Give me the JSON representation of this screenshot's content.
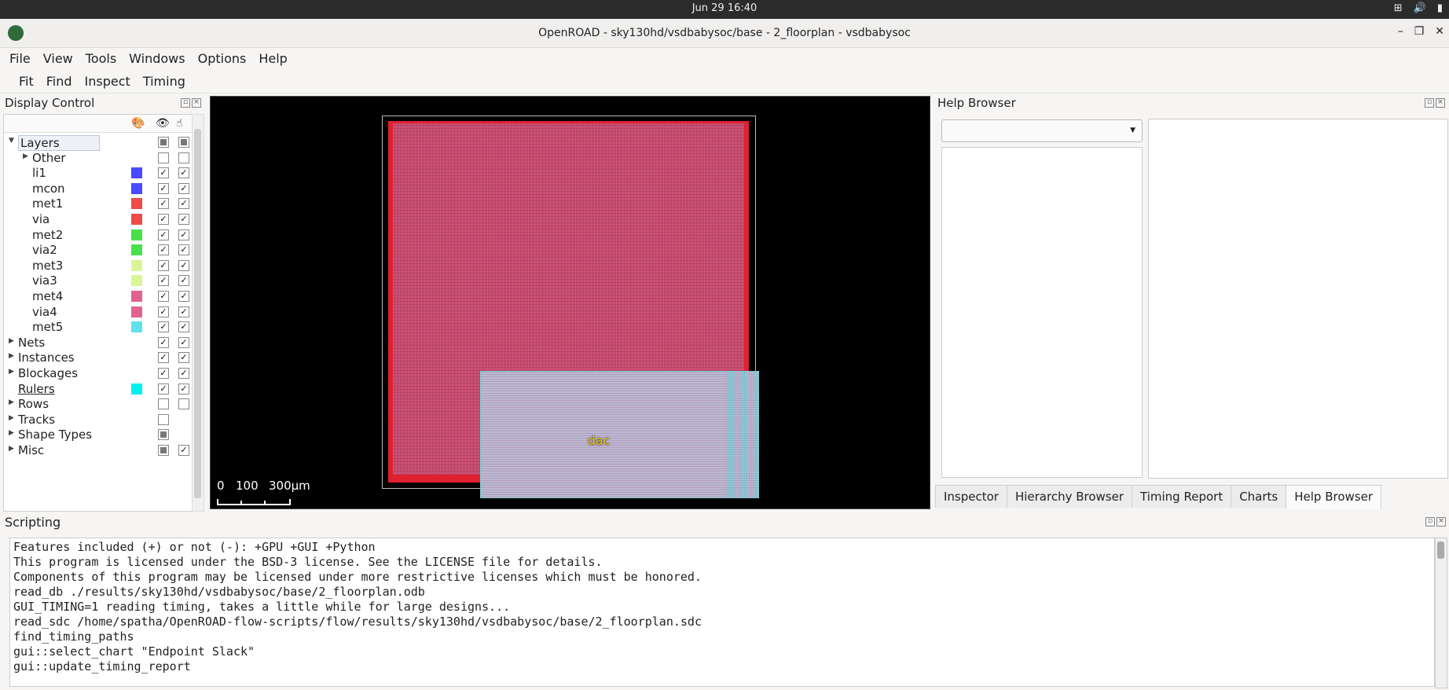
{
  "system": {
    "clock": "Jun 29  16:40"
  },
  "window": {
    "title": "OpenROAD - sky130hd/vsdbabysoc/base - 2_floorplan - vsdbabysoc"
  },
  "menu": [
    "File",
    "View",
    "Tools",
    "Windows",
    "Options",
    "Help"
  ],
  "toolbar": [
    "Fit",
    "Find",
    "Inspect",
    "Timing"
  ],
  "display_control": {
    "title": "Display Control",
    "rows": [
      {
        "label": "Layers",
        "level": 0,
        "expanded": true,
        "vis": "partial",
        "sel": "partial",
        "swatch": null
      },
      {
        "label": "Other",
        "level": 1,
        "expanded": false,
        "vis": "unchecked",
        "sel": "unchecked",
        "swatch": null
      },
      {
        "label": "li1",
        "level": 1,
        "vis": "checked",
        "sel": "checked",
        "swatch": "#4a4aff"
      },
      {
        "label": "mcon",
        "level": 1,
        "vis": "checked",
        "sel": "checked",
        "swatch": "#4a4aff"
      },
      {
        "label": "met1",
        "level": 1,
        "vis": "checked",
        "sel": "checked",
        "swatch": "#f04a4a"
      },
      {
        "label": "via",
        "level": 1,
        "vis": "checked",
        "sel": "checked",
        "swatch": "#f04a4a"
      },
      {
        "label": "met2",
        "level": 1,
        "vis": "checked",
        "sel": "checked",
        "swatch": "#4ae04a"
      },
      {
        "label": "via2",
        "level": 1,
        "vis": "checked",
        "sel": "checked",
        "swatch": "#4ae04a"
      },
      {
        "label": "met3",
        "level": 1,
        "vis": "checked",
        "sel": "checked",
        "swatch": "#d8f598"
      },
      {
        "label": "via3",
        "level": 1,
        "vis": "checked",
        "sel": "checked",
        "swatch": "#d8f598"
      },
      {
        "label": "met4",
        "level": 1,
        "vis": "checked",
        "sel": "checked",
        "swatch": "#e2628c"
      },
      {
        "label": "via4",
        "level": 1,
        "vis": "checked",
        "sel": "checked",
        "swatch": "#e2628c"
      },
      {
        "label": "met5",
        "level": 1,
        "vis": "checked",
        "sel": "checked",
        "swatch": "#5ee2ee"
      },
      {
        "label": "Nets",
        "level": 0,
        "expanded": false,
        "vis": "checked",
        "sel": "checked",
        "swatch": null
      },
      {
        "label": "Instances",
        "level": 0,
        "expanded": false,
        "vis": "checked",
        "sel": "checked",
        "swatch": null
      },
      {
        "label": "Blockages",
        "level": 0,
        "expanded": false,
        "vis": "checked",
        "sel": "checked",
        "swatch": null
      },
      {
        "label": "Rulers",
        "level": 0,
        "vis": "checked",
        "sel": "checked",
        "swatch": "#00f0f0"
      },
      {
        "label": "Rows",
        "level": 0,
        "expanded": false,
        "vis": "unchecked",
        "sel": "unchecked",
        "swatch": null
      },
      {
        "label": "Tracks",
        "level": 0,
        "expanded": false,
        "vis": "unchecked",
        "sel": null,
        "swatch": null
      },
      {
        "label": "Shape Types",
        "level": 0,
        "expanded": false,
        "vis": "partial",
        "sel": null,
        "swatch": null
      },
      {
        "label": "Misc",
        "level": 0,
        "expanded": false,
        "vis": "partial",
        "sel": "checked",
        "swatch": null
      }
    ]
  },
  "layout_view": {
    "macro_label": "dac",
    "scale": {
      "t0": "0",
      "t1": "100",
      "t2": "300μm"
    }
  },
  "help_browser": {
    "title": "Help Browser"
  },
  "tabs": [
    "Inspector",
    "Hierarchy Browser",
    "Timing Report",
    "Charts",
    "Help Browser"
  ],
  "active_tab": "Help Browser",
  "scripting": {
    "title": "Scripting",
    "lines": [
      "Features included (+) or not (-): +GPU +GUI +Python",
      "This program is licensed under the BSD-3 license. See the LICENSE file for details.",
      "Components of this program may be licensed under more restrictive licenses which must be honored.",
      "read_db ./results/sky130hd/vsdbabysoc/base/2_floorplan.odb",
      "GUI_TIMING=1 reading timing, takes a little while for large designs...",
      "read_sdc /home/spatha/OpenROAD-flow-scripts/flow/results/sky130hd/vsdbabysoc/base/2_floorplan.sdc",
      "find_timing_paths",
      "gui::select_chart \"Endpoint Slack\"",
      "gui::update_timing_report"
    ]
  }
}
